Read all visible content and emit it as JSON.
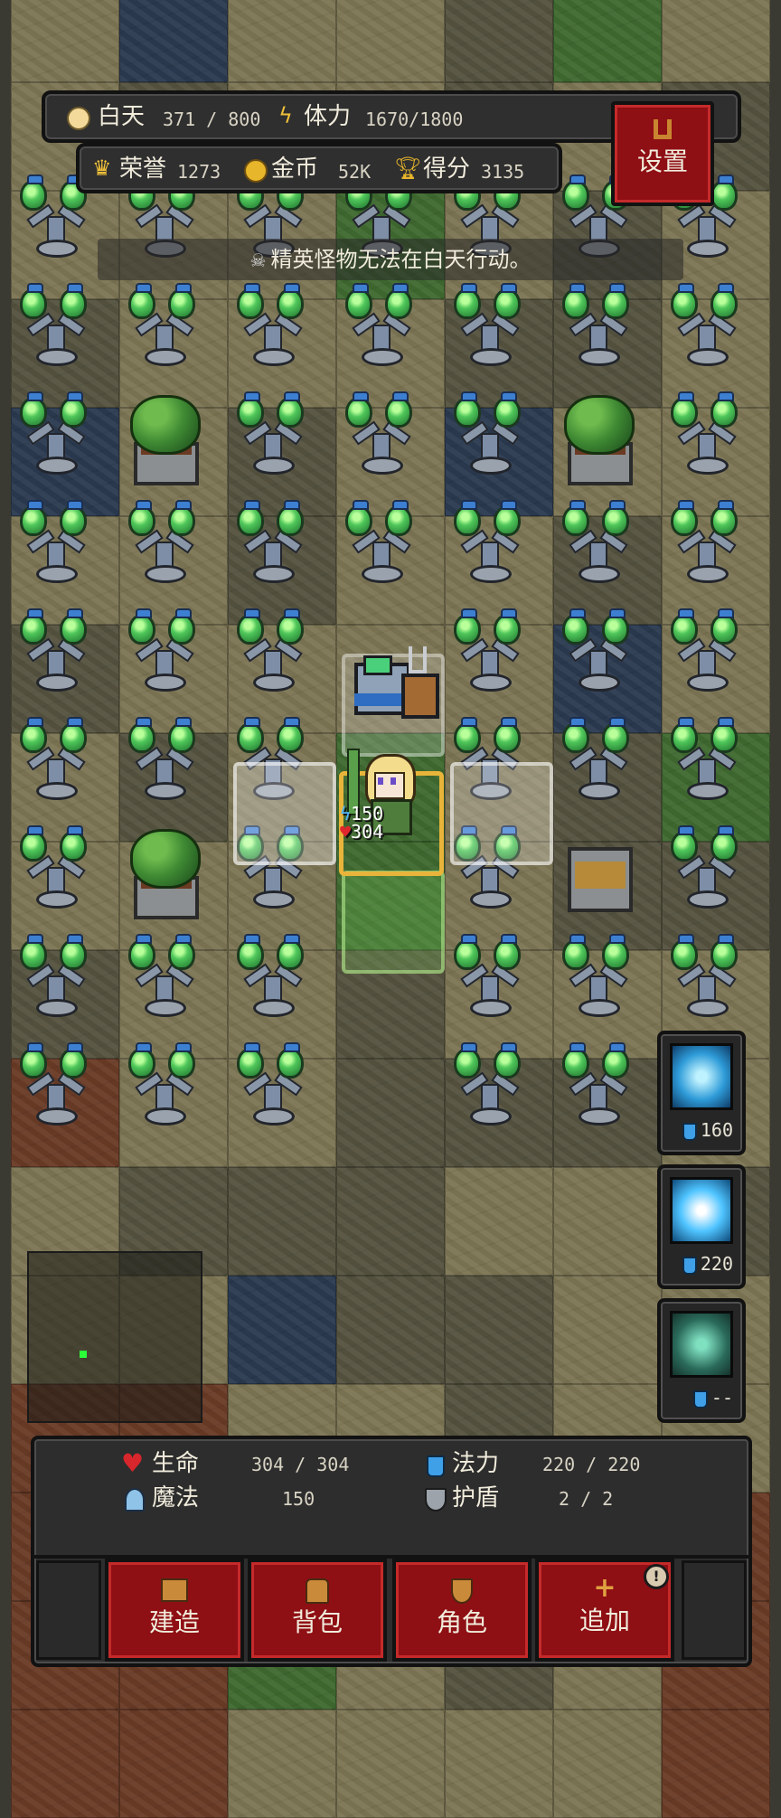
{
  "hud": {
    "day_label": "白天",
    "day_value": "371 / 800",
    "stamina_label": "体力",
    "stamina_value": "1670/1800",
    "honor_label": "荣誉",
    "honor_value": "1273",
    "gold_label": "金币",
    "gold_value": "52K",
    "score_label": "得分",
    "score_value": "3135",
    "settings_label": "设置"
  },
  "notice": "精英怪物无法在白天行动。",
  "player": {
    "mp": "150",
    "hp": "304"
  },
  "skills": [
    {
      "name": "lightning-skill-icon",
      "cost": "160"
    },
    {
      "name": "frost-skill-icon",
      "cost": "220"
    },
    {
      "name": "shield-skill-icon",
      "cost": "--"
    }
  ],
  "stats": {
    "hp_label": "生命",
    "hp_value": "304 / 304",
    "mana_label": "法力",
    "mana_value": "220 / 220",
    "magic_label": "魔法",
    "magic_value": "150",
    "shield_label": "护盾",
    "shield_value": "2  /  2"
  },
  "actions": {
    "build": "建造",
    "bag": "背包",
    "character": "角色",
    "add": "追加"
  },
  "colors": {
    "accent_red": "#8e0f14",
    "selection": "#e8b43a",
    "minimap_dot": "#2aff3a"
  }
}
